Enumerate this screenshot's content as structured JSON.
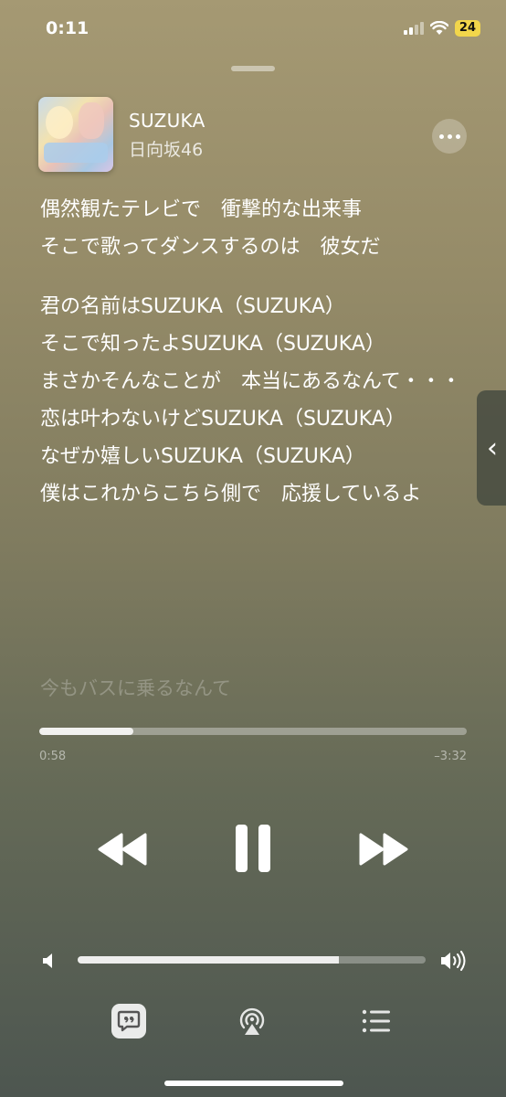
{
  "status_bar": {
    "time": "0:11",
    "battery": "24"
  },
  "track": {
    "title": "SUZUKA",
    "artist": "日向坂46"
  },
  "lyrics": [
    "偶然観たテレビで　衝撃的な出来事",
    "そこで歌ってダンスするのは　彼女だ",
    "君の名前はSUZUKA（SUZUKA）",
    "そこで知ったよSUZUKA（SUZUKA）",
    "まさかそんなことが　本当にあるなんて・・・",
    "恋は叶わないけどSUZUKA（SUZUKA）",
    "なぜか嬉しいSUZUKA（SUZUKA）",
    "僕はこれからこちら側で　応援しているよ",
    "今もバスに乗るなんて"
  ],
  "playback": {
    "elapsed": "0:58",
    "remaining": "–3:32",
    "progress": 0.22
  },
  "volume": {
    "level": 0.75
  },
  "icons": {
    "more": "more-icon",
    "side_tab": "chevron-left-icon",
    "prev": "backward-icon",
    "pause": "pause-icon",
    "next": "forward-icon",
    "lyrics": "lyrics-icon",
    "airplay": "airplay-icon",
    "queue": "queue-icon"
  }
}
